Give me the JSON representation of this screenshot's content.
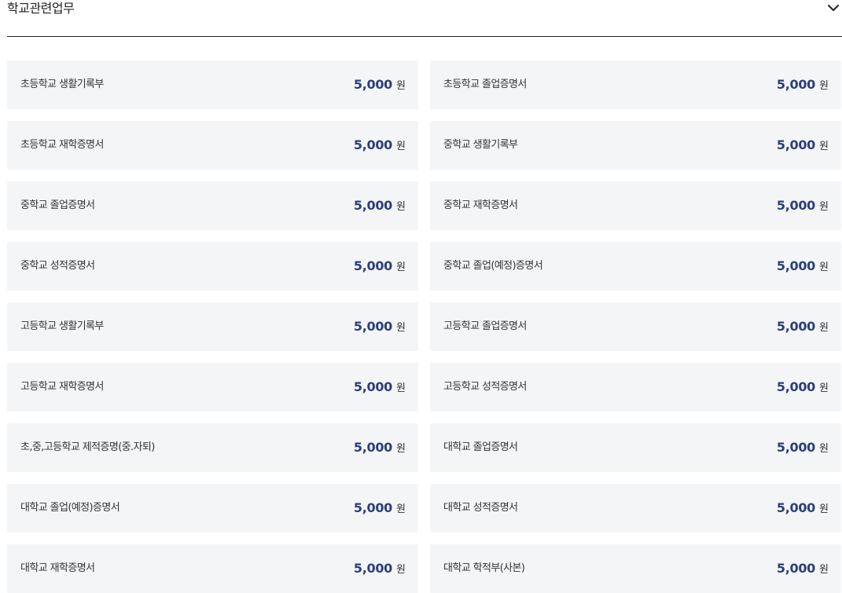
{
  "section": {
    "title": "학교관련업무",
    "toggle_icon": "chevron-down-icon"
  },
  "colors": {
    "accent": "#2c3e7a",
    "card_bg": "#f4f5f7",
    "divider": "#222222"
  },
  "fees": [
    {
      "name": "초등학교 생활기록부",
      "amount": "5,000",
      "unit": "원"
    },
    {
      "name": "초등학교 졸업증명서",
      "amount": "5,000",
      "unit": "원"
    },
    {
      "name": "초등학교 재학증명서",
      "amount": "5,000",
      "unit": "원"
    },
    {
      "name": "중학교 생활기록부",
      "amount": "5,000",
      "unit": "원"
    },
    {
      "name": "중학교 졸업증명서",
      "amount": "5,000",
      "unit": "원"
    },
    {
      "name": "중학교 재학증명서",
      "amount": "5,000",
      "unit": "원"
    },
    {
      "name": "중학교 성적증명서",
      "amount": "5,000",
      "unit": "원"
    },
    {
      "name": "중학교 졸업(예정)증명서",
      "amount": "5,000",
      "unit": "원"
    },
    {
      "name": "고등학교 생활기록부",
      "amount": "5,000",
      "unit": "원"
    },
    {
      "name": "고등학교 졸업증명서",
      "amount": "5,000",
      "unit": "원"
    },
    {
      "name": "고등학교 재학증명서",
      "amount": "5,000",
      "unit": "원"
    },
    {
      "name": "고등학교 성적증명서",
      "amount": "5,000",
      "unit": "원"
    },
    {
      "name": "초,중,고등학교 제적증명(중.자퇴)",
      "amount": "5,000",
      "unit": "원"
    },
    {
      "name": "대학교 졸업증명서",
      "amount": "5,000",
      "unit": "원"
    },
    {
      "name": "대학교 졸업(예정)증명서",
      "amount": "5,000",
      "unit": "원"
    },
    {
      "name": "대학교 성적증명서",
      "amount": "5,000",
      "unit": "원"
    },
    {
      "name": "대학교 재학증명서",
      "amount": "5,000",
      "unit": "원"
    },
    {
      "name": "대학교 학적부(사본)",
      "amount": "5,000",
      "unit": "원"
    }
  ]
}
